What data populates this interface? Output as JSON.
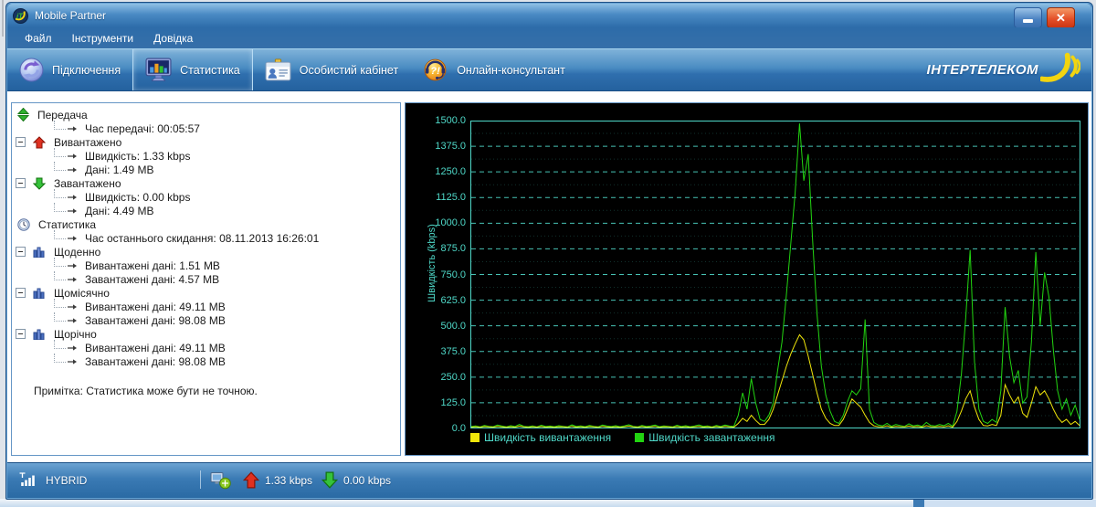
{
  "window": {
    "title": "Mobile Partner"
  },
  "menu": {
    "items": [
      "Файл",
      "Інструменти",
      "Довідка"
    ]
  },
  "toolbar": {
    "buttons": [
      {
        "label": "Підключення",
        "icon": "sync-icon",
        "selected": false
      },
      {
        "label": "Статистика",
        "icon": "statistics-icon",
        "selected": true
      },
      {
        "label": "Особистий кабінет",
        "icon": "id-card-icon",
        "selected": false
      },
      {
        "label": "Онлайн-консультант",
        "icon": "online-consultant-icon",
        "selected": false
      }
    ],
    "logo": "ІНТЕРТЕЛЕКОМ"
  },
  "tree": {
    "items": [
      {
        "level": 0,
        "icon": "transfer-icon",
        "expander": false,
        "label": "Передача"
      },
      {
        "level": 1,
        "icon": "leaf-arrow-icon",
        "label": "Час передачі: 00:05:57"
      },
      {
        "level": 0,
        "icon": "upload-icon",
        "expander": true,
        "label": "Вивантажено"
      },
      {
        "level": 1,
        "icon": "leaf-arrow-icon",
        "label": "Швидкість: 1.33 kbps"
      },
      {
        "level": 1,
        "icon": "leaf-arrow-icon",
        "label": "Дані: 1.49 MB"
      },
      {
        "level": 0,
        "icon": "download-icon",
        "expander": true,
        "label": "Завантажено"
      },
      {
        "level": 1,
        "icon": "leaf-arrow-icon",
        "label": "Швидкість: 0.00 kbps"
      },
      {
        "level": 1,
        "icon": "leaf-arrow-icon",
        "label": "Дані: 4.49 MB"
      },
      {
        "level": 0,
        "icon": "clock-icon",
        "expander": false,
        "label": "Статистика"
      },
      {
        "level": 1,
        "icon": "leaf-arrow-icon",
        "label": "Час останнього скидання: 08.11.2013 16:26:01"
      },
      {
        "level": 0,
        "icon": "bars-icon",
        "expander": true,
        "label": "Щоденно"
      },
      {
        "level": 1,
        "icon": "leaf-arrow-icon",
        "label": "Вивантажені дані: 1.51 MB"
      },
      {
        "level": 1,
        "icon": "leaf-arrow-icon",
        "label": "Завантажені дані: 4.57 MB"
      },
      {
        "level": 0,
        "icon": "bars-icon",
        "expander": true,
        "label": "Щомісячно"
      },
      {
        "level": 1,
        "icon": "leaf-arrow-icon",
        "label": "Вивантажені дані: 49.11 MB"
      },
      {
        "level": 1,
        "icon": "leaf-arrow-icon",
        "label": "Завантажені дані: 98.08 MB"
      },
      {
        "level": 0,
        "icon": "bars-icon",
        "expander": true,
        "label": "Щорічно"
      },
      {
        "level": 1,
        "icon": "leaf-arrow-icon",
        "label": "Вивантажені дані: 49.11 MB"
      },
      {
        "level": 1,
        "icon": "leaf-arrow-icon",
        "label": "Завантажені дані: 98.08 MB"
      }
    ],
    "note": "Примітка: Статистика може бути не точною."
  },
  "chart_data": {
    "type": "line",
    "title": "",
    "xlabel": "",
    "ylabel": "Швидкість (kbps)",
    "ylim": [
      0,
      1500
    ],
    "ytick_step": 125,
    "grid": "horizontal-dashed",
    "background": "#000000",
    "axis_color": "#4fd8c8",
    "legend_position": "bottom-left",
    "series": [
      {
        "name": "Швидкість вивантаження",
        "color": "#f0e60a",
        "values": [
          2,
          4,
          1,
          5,
          3,
          2,
          6,
          3,
          1,
          4,
          2,
          7,
          3,
          1,
          4,
          2,
          5,
          2,
          3,
          1,
          4,
          3,
          1,
          6,
          2,
          4,
          1,
          5,
          3,
          1,
          6,
          3,
          2,
          4,
          1,
          4,
          7,
          3,
          1,
          5,
          2,
          3,
          6,
          1,
          4,
          3,
          1,
          5,
          2,
          4,
          1,
          3,
          6,
          2,
          4,
          1,
          5,
          2,
          6,
          3,
          2,
          20,
          45,
          30,
          60,
          35,
          15,
          15,
          40,
          90,
          160,
          230,
          300,
          360,
          410,
          455,
          430,
          350,
          260,
          170,
          90,
          45,
          20,
          10,
          10,
          40,
          90,
          140,
          120,
          100,
          60,
          25,
          8,
          4,
          3,
          8,
          2,
          6,
          4,
          3,
          7,
          3,
          5,
          2,
          9,
          4,
          3,
          6,
          3,
          8,
          2,
          30,
          80,
          140,
          180,
          100,
          40,
          10,
          8,
          15,
          10,
          60,
          210,
          160,
          120,
          150,
          70,
          50,
          120,
          200,
          160,
          180,
          140,
          90,
          50,
          25,
          40,
          15,
          30,
          10
        ]
      },
      {
        "name": "Швидкість завантаження",
        "color": "#22d411",
        "values": [
          5,
          8,
          3,
          10,
          6,
          4,
          12,
          7,
          3,
          9,
          5,
          15,
          6,
          4,
          8,
          3,
          11,
          5,
          7,
          4,
          9,
          6,
          3,
          13,
          5,
          8,
          4,
          10,
          6,
          3,
          12,
          7,
          5,
          9,
          4,
          8,
          14,
          6,
          3,
          10,
          5,
          7,
          12,
          4,
          8,
          6,
          3,
          11,
          5,
          9,
          4,
          7,
          13,
          6,
          8,
          3,
          10,
          5,
          12,
          7,
          6,
          60,
          170,
          90,
          240,
          120,
          40,
          30,
          60,
          120,
          280,
          420,
          650,
          900,
          1150,
          1490,
          1210,
          1340,
          920,
          560,
          300,
          160,
          80,
          30,
          20,
          60,
          130,
          180,
          160,
          190,
          530,
          90,
          25,
          12,
          8,
          20,
          6,
          15,
          10,
          5,
          18,
          8,
          12,
          6,
          25,
          10,
          7,
          15,
          9,
          20,
          6,
          80,
          260,
          540,
          870,
          320,
          90,
          30,
          20,
          40,
          25,
          180,
          590,
          350,
          220,
          280,
          120,
          150,
          420,
          860,
          500,
          760,
          640,
          380,
          180,
          90,
          140,
          60,
          110,
          40
        ]
      }
    ]
  },
  "statusbar": {
    "network_mode": "HYBRID",
    "upload_speed": "1.33 kbps",
    "download_speed": "0.00 kbps"
  },
  "colors": {
    "chrome_blue": "#2d6ca9",
    "panel_border": "#6596c6",
    "chart_teal": "#4fd8c8",
    "upload_yellow": "#f0e60a",
    "download_green": "#22d411",
    "close_red": "#e4512a"
  }
}
